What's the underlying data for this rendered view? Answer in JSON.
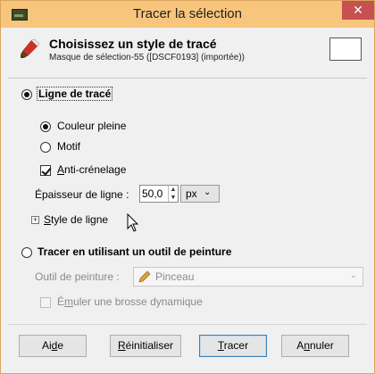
{
  "window": {
    "title": "Tracer la sélection",
    "close_glyph": "✕"
  },
  "header": {
    "title": "Choisissez un style de tracé",
    "subtitle": "Masque de sélection-55 ([DSCF0193] (importée))",
    "icon": "paint-brush-icon"
  },
  "stroke_line": {
    "label": "Ligne de tracé",
    "selected": true,
    "fill_options": [
      {
        "label": "Couleur pleine",
        "selected": true
      },
      {
        "label": "Motif",
        "selected": false
      }
    ],
    "antialias": {
      "label_mn": "A",
      "label_rest": "nti-crénelage",
      "checked": true
    },
    "line_width": {
      "label": "Épaisseur de ligne :",
      "value": "50,0",
      "unit": "px"
    },
    "line_style": {
      "label_mn": "S",
      "label_rest": "tyle de ligne"
    }
  },
  "paint_tool": {
    "label": "Tracer en utilisant un outil de peinture",
    "selected": false,
    "tool_label": "Outil de peinture :",
    "tool_value": "Pinceau",
    "emulate": {
      "label_pre": "É",
      "label_mn": "m",
      "label_rest": "uler une brosse dynamique",
      "checked": false
    }
  },
  "buttons": {
    "help": {
      "pre": "Ai",
      "mn": "d",
      "post": "e"
    },
    "reset": {
      "pre": "",
      "mn": "R",
      "post": "éinitialiser"
    },
    "stroke": {
      "pre": "",
      "mn": "T",
      "post": "racer"
    },
    "cancel": {
      "pre": "A",
      "mn": "n",
      "post": "nuler"
    }
  },
  "colors": {
    "titlebar": "#f8c57c",
    "close": "#c75050",
    "focus_border": "#3c7fb1"
  }
}
